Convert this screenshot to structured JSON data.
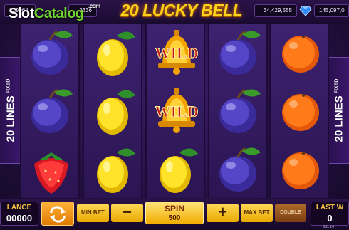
{
  "header": {
    "jackpot_left": "329964",
    "jackpot_mid": "2336",
    "jackpot_right_a": "34,429,555",
    "jackpot_right_b": "145,097,0",
    "title": "20 LUCKY BELL"
  },
  "watermark": {
    "slot": "Slot",
    "catalog": "Catalog",
    "com": ".com"
  },
  "side_panels": {
    "left_label": "20 LINES",
    "left_sub": "FIXED",
    "right_label": "20 LINES",
    "right_sub": "FIXED"
  },
  "reels": [
    [
      "plum",
      "plum",
      "strawberry"
    ],
    [
      "lemon",
      "lemon",
      "lemon"
    ],
    [
      "wild",
      "wild",
      "lemon"
    ],
    [
      "plum",
      "plum",
      "plum"
    ],
    [
      "orange",
      "orange",
      "orange"
    ]
  ],
  "symbols": {
    "wild_text": "WILD"
  },
  "controls": {
    "balance_label": "LANCE",
    "balance_value": "00000",
    "min_bet": "MIN BET",
    "minus": "−",
    "spin_label": "SPIN",
    "spin_bet": "500",
    "plus": "+",
    "max_bet": "MAX BET",
    "double": "DOUBLE",
    "last_win_label": "LAST W",
    "last_win_value": "0",
    "clock": "02:14"
  },
  "colors": {
    "accent": "#ffd21a",
    "button": "#f2ad00",
    "reel_bg": "#3d2270"
  }
}
